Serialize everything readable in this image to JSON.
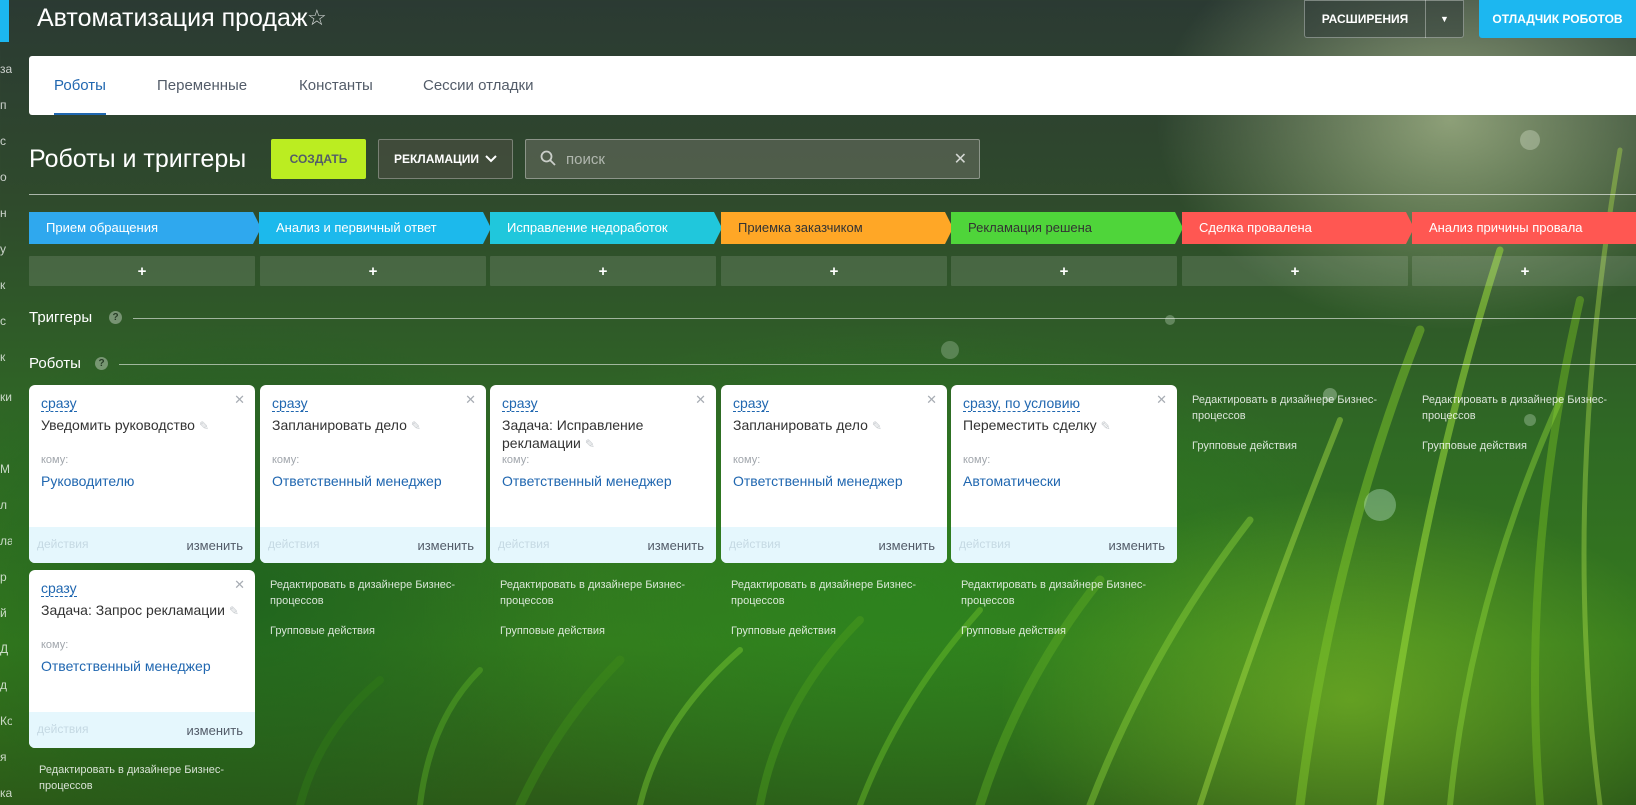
{
  "header": {
    "title": "Автоматизация продаж",
    "extensions_label": "РАСШИРЕНИЯ",
    "debugger_label": "ОТЛАДЧИК РОБОТОВ"
  },
  "sidebar_fragments": [
    "за",
    "п",
    "с",
    "о",
    "н",
    "у",
    "к",
    "с",
    "к",
    "ки",
    "М",
    "л",
    "ла",
    "р",
    "й",
    "Д",
    "д",
    "Ко",
    "я",
    "ка"
  ],
  "tabs": [
    {
      "label": "Роботы",
      "active": true
    },
    {
      "label": "Переменные",
      "active": false
    },
    {
      "label": "Константы",
      "active": false
    },
    {
      "label": "Сессии отладки",
      "active": false
    }
  ],
  "toolbar": {
    "title": "Роботы и триггеры",
    "create_label": "СОЗДАТЬ",
    "filter_label": "РЕКЛАМАЦИИ",
    "search_placeholder": "поиск"
  },
  "stages": [
    {
      "name": "Прием обращения",
      "color": "#2fa8ee"
    },
    {
      "name": "Анализ и первичный ответ",
      "color": "#1cb9ec"
    },
    {
      "name": "Исправление недоработок",
      "color": "#20c7dc"
    },
    {
      "name": "Приемка заказчиком",
      "color": "#ffa726"
    },
    {
      "name": "Рекламация решена",
      "color": "#4fd53a"
    },
    {
      "name": "Сделка провалена",
      "color": "#ff5752"
    },
    {
      "name": "Анализ причины провала",
      "color": "#ff5752"
    }
  ],
  "add_symbol": "+",
  "sections": {
    "triggers": "Триггеры",
    "robots": "Роботы",
    "help": "?"
  },
  "card_labels": {
    "to": "кому:",
    "actions": "действия",
    "edit": "изменить"
  },
  "robots": [
    {
      "when": "сразу",
      "name": "Уведомить руководство",
      "to": "Руководителю"
    },
    {
      "when": "сразу",
      "name": "Запланировать дело",
      "to": "Ответственный менеджер"
    },
    {
      "when": "сразу",
      "name": "Задача: Исправление рекламации",
      "to": "Ответственный менеджер"
    },
    {
      "when": "сразу",
      "name": "Запланировать дело",
      "to": "Ответственный менеджер"
    },
    {
      "when": "сразу, по условию",
      "name": "Переместить сделку",
      "to": "Автоматически"
    },
    {
      "when": "сразу",
      "name": "Задача: Запрос рекламации",
      "to": "Ответственный менеджер"
    }
  ],
  "links": {
    "designer": "Редактировать в дизайнере Бизнес-процессов",
    "group": "Групповые действия"
  }
}
